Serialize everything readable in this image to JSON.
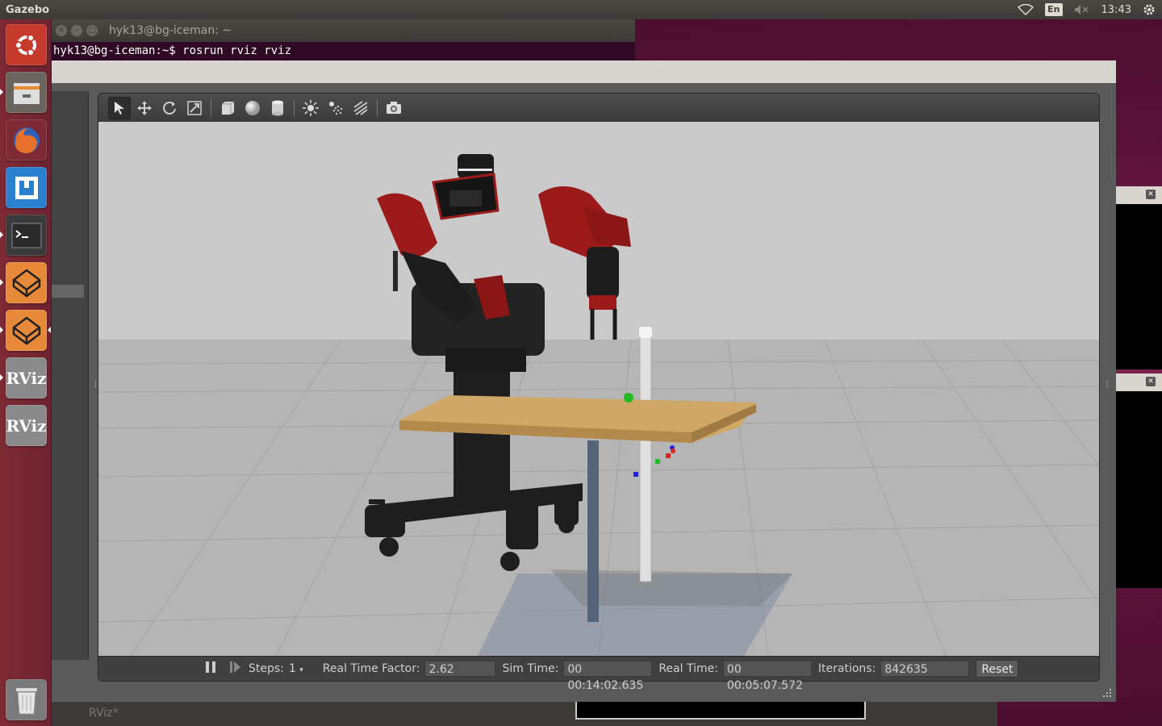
{
  "top_panel": {
    "app_name": "Gazebo",
    "keyboard_layout": "En",
    "clock": "13:43",
    "icons": [
      "wifi-icon",
      "keyboard-layout-indicator",
      "volume-muted-icon",
      "settings-gear-icon"
    ]
  },
  "launcher": {
    "items": [
      {
        "name": "dash-home",
        "icon": "ubuntu-logo-icon",
        "color": "#c63a2c"
      },
      {
        "name": "files",
        "icon": "file-cabinet-icon",
        "color": "#6b6560"
      },
      {
        "name": "firefox",
        "icon": "firefox-icon",
        "color": "#7e2a35"
      },
      {
        "name": "qt-creator",
        "icon": "qt-bracket-icon",
        "color": "#2a7fcf"
      },
      {
        "name": "terminal",
        "icon": "terminal-icon",
        "color": "#3a3a3a"
      },
      {
        "name": "gazebo-1",
        "icon": "gazebo-icon",
        "color": "#e8893a"
      },
      {
        "name": "gazebo-2",
        "icon": "gazebo-icon",
        "color": "#e8893a"
      },
      {
        "name": "rviz-1",
        "icon": "rviz-icon",
        "label": "RViz",
        "color": "#8a8a8a"
      },
      {
        "name": "rviz-2",
        "icon": "rviz-icon",
        "label": "RViz",
        "color": "#8a8a8a"
      },
      {
        "name": "trash",
        "icon": "trash-icon",
        "color": "#7a7a7a"
      }
    ]
  },
  "terminal": {
    "title": "hyk13@bg-iceman: ~",
    "command_line": "hyk13@bg-iceman:~$ rosrun rviz rviz"
  },
  "background_window": {
    "title": "RViz*"
  },
  "gazebo": {
    "toolbar": {
      "tools": [
        {
          "name": "select-mode",
          "icon": "arrow-cursor-icon",
          "active": true
        },
        {
          "name": "translate-mode",
          "icon": "move-arrows-icon"
        },
        {
          "name": "rotate-mode",
          "icon": "rotate-icon"
        },
        {
          "name": "scale-mode",
          "icon": "scale-icon"
        },
        {
          "name": "box-shape",
          "icon": "box-icon"
        },
        {
          "name": "sphere-shape",
          "icon": "sphere-icon"
        },
        {
          "name": "cylinder-shape",
          "icon": "cylinder-icon"
        },
        {
          "name": "point-light",
          "icon": "point-light-icon"
        },
        {
          "name": "spot-light",
          "icon": "spot-light-icon"
        },
        {
          "name": "directional-light",
          "icon": "directional-light-icon"
        },
        {
          "name": "screenshot",
          "icon": "camera-icon"
        }
      ]
    },
    "statusbar": {
      "steps_label": "Steps:",
      "steps_value": "1",
      "rtf_label": "Real Time Factor:",
      "rtf_value": "2.62",
      "sim_time_label": "Sim Time:",
      "sim_time_value": "00 00:14:02.635",
      "real_time_label": "Real Time:",
      "real_time_value": "00 00:05:07.572",
      "iterations_label": "Iterations:",
      "iterations_value": "842635",
      "reset_label": "Reset"
    },
    "scene": {
      "ground_color": "#b7b7b7",
      "sky_color": "#cacaca",
      "robot_body_color": "#1f1f1f",
      "robot_accent_color": "#9c1a1a",
      "table_color": "#c9a15e",
      "marker_colors": [
        "#22bb22",
        "#dd2222",
        "#2222dd"
      ]
    }
  }
}
